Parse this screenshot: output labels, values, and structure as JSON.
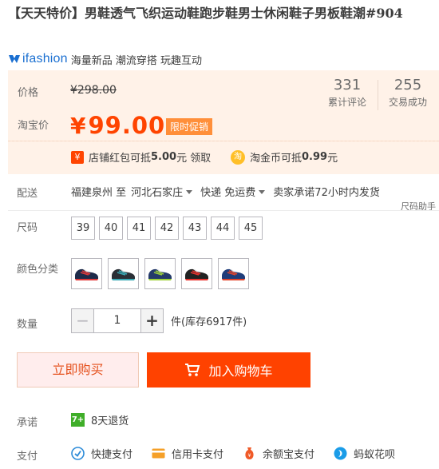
{
  "product": {
    "title": "【天天特价】男鞋透气飞织运动鞋跑步鞋男士休闲鞋子男板鞋潮#904"
  },
  "brand": {
    "logo_text": "ifashion",
    "tagline": "海量新品 潮流穿搭 玩趣互动"
  },
  "price": {
    "price_label": "价格",
    "original": "¥298.00",
    "taobao_label": "淘宝价",
    "currency": "¥",
    "current": "99.00",
    "promo_tag": "限时促销",
    "accent_color": "#ff4400"
  },
  "stats": [
    {
      "value": "331",
      "caption": "累计评论"
    },
    {
      "value": "255",
      "caption": "交易成功"
    }
  ],
  "coupons": [
    {
      "icon": "red-packet-icon",
      "prefix": "店铺红包可抵",
      "amount": "5.00",
      "suffix": "元",
      "action": "领取"
    },
    {
      "icon": "taojinbi-icon",
      "prefix": "淘金币可抵",
      "amount": "0.99",
      "suffix": "元"
    }
  ],
  "delivery": {
    "label": "配送",
    "from": "福建泉州 至",
    "to": "河北石家庄",
    "shipping": "快递 免运费",
    "promise": "卖家承诺72小时内发货",
    "size_helper": "尺码助手"
  },
  "sizes": {
    "label": "尺码",
    "options": [
      "39",
      "40",
      "41",
      "42",
      "43",
      "44",
      "45"
    ]
  },
  "colors": {
    "label": "颜色分类",
    "swatches": [
      {
        "icon": "shoe-thumbnail-navy-red",
        "color": "#1e2b4a",
        "accent": "#e03a3a"
      },
      {
        "icon": "shoe-thumbnail-black-teal",
        "color": "#2a2f36",
        "accent": "#3aa9b5"
      },
      {
        "icon": "shoe-thumbnail-navy-green",
        "color": "#243a6a",
        "accent": "#9ed13a"
      },
      {
        "icon": "shoe-thumbnail-black-red",
        "color": "#222222",
        "accent": "#e8332e"
      },
      {
        "icon": "shoe-thumbnail-blue-red",
        "color": "#1f3d7a",
        "accent": "#e2452b"
      }
    ]
  },
  "quantity": {
    "label": "数量",
    "minus": "−",
    "value": "1",
    "plus": "+",
    "unit": "件(库存6917件)"
  },
  "actions": {
    "buy_now": "立即购买",
    "add_to_cart": "加入购物车"
  },
  "promise": {
    "label": "承诺",
    "icon_text": "7+",
    "text": "8天退货"
  },
  "payment": {
    "label": "支付",
    "methods": [
      {
        "icon": "quick-pay-icon",
        "text": "快捷支付",
        "color": "#2c8bd8"
      },
      {
        "icon": "credit-card-icon",
        "text": "信用卡支付",
        "color": "#f5a028"
      },
      {
        "icon": "yuebao-icon",
        "text": "余额宝支付",
        "color": "#f05a28"
      },
      {
        "icon": "huabei-icon",
        "text": "蚂蚁花呗",
        "color": "#1a9ce8"
      }
    ]
  }
}
